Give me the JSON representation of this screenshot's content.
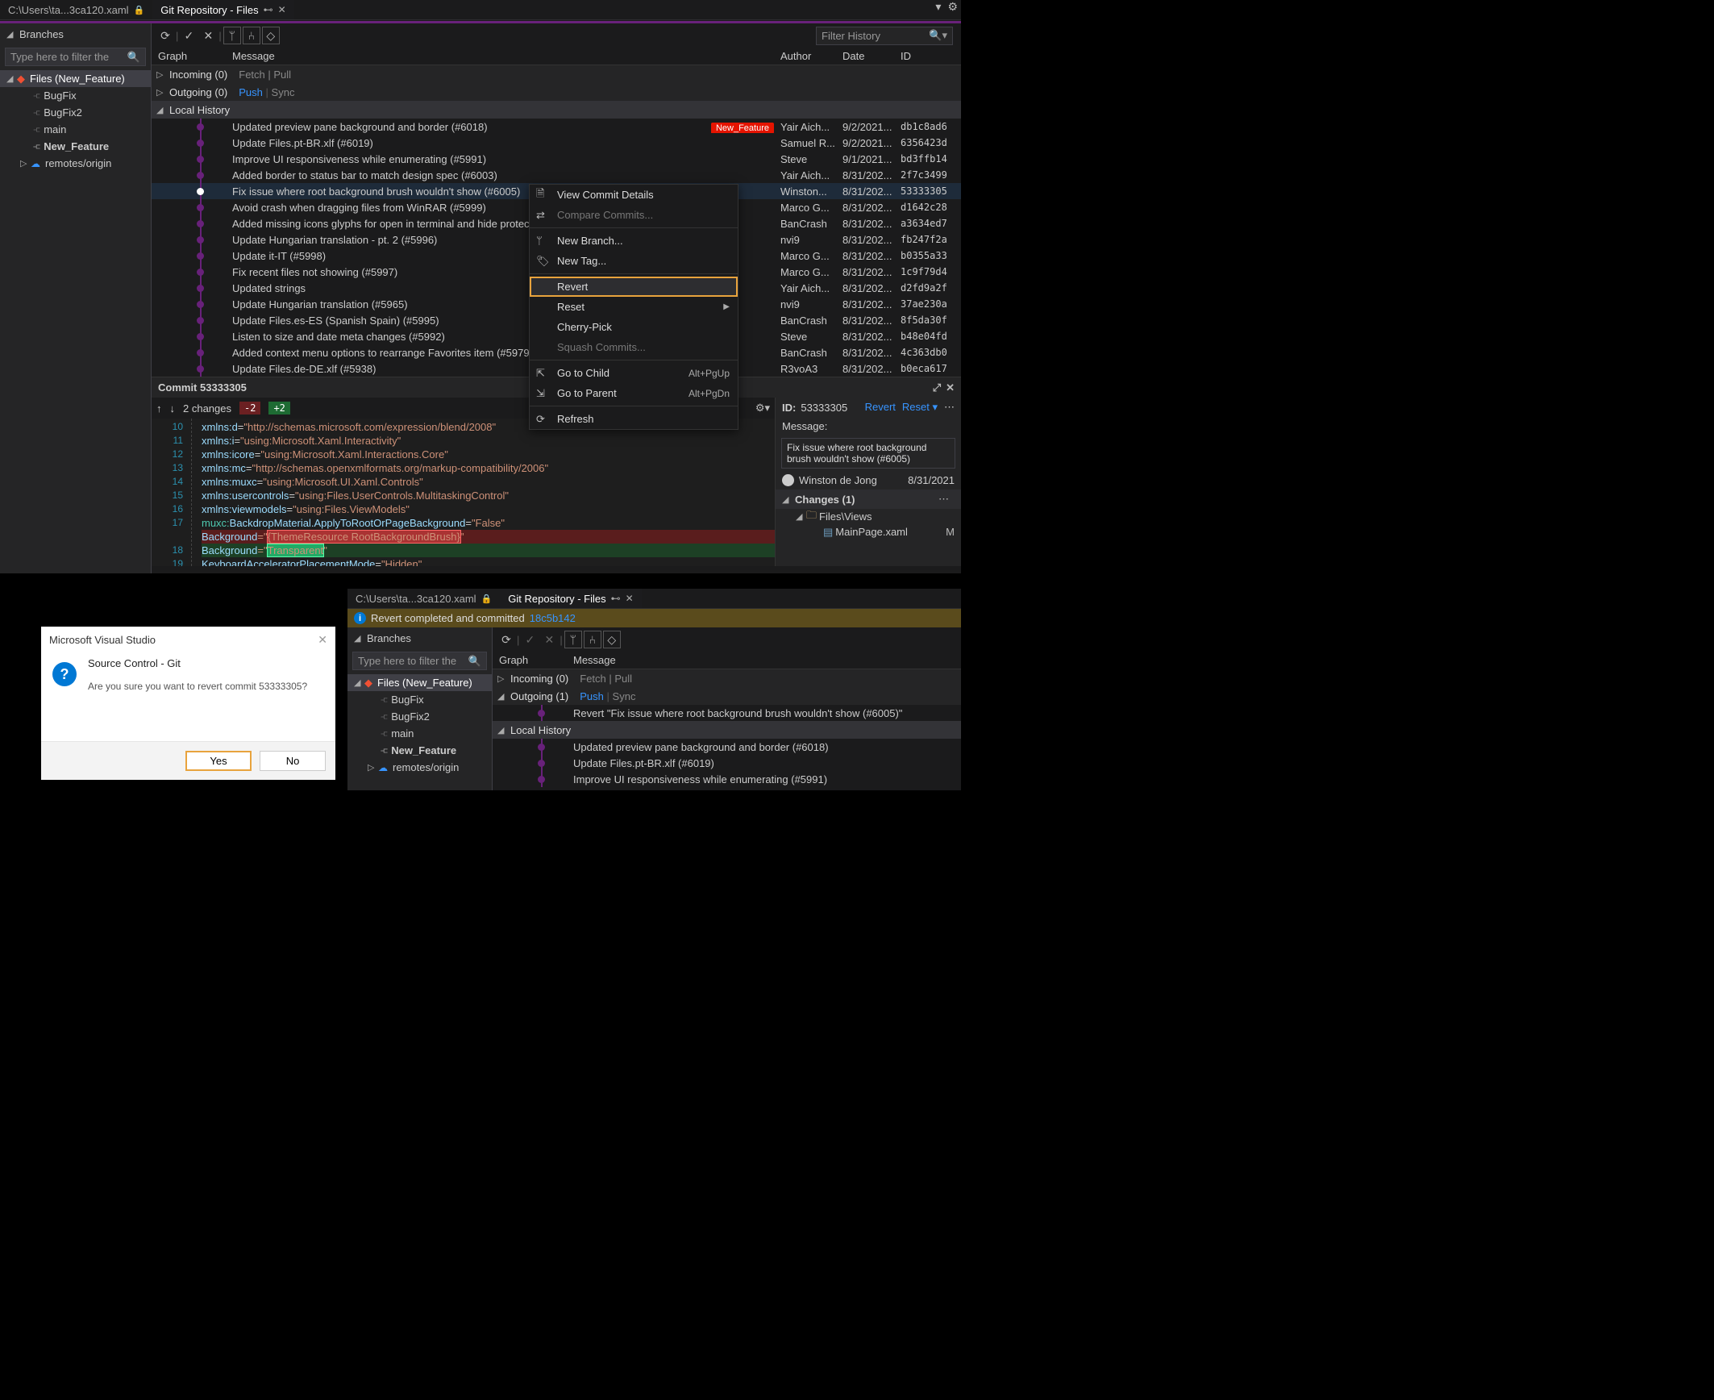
{
  "tabs": {
    "file_tab": "C:\\Users\\ta...3ca120.xaml",
    "repo_tab": "Git Repository - Files"
  },
  "branches": {
    "title": "Branches",
    "search_placeholder": "Type here to filter the",
    "current": "Files (New_Feature)",
    "local": [
      "BugFix",
      "BugFix2",
      "main",
      "New_Feature"
    ],
    "remotes_label": "remotes/origin"
  },
  "toolbar": {
    "filter_placeholder": "Filter History"
  },
  "columns": {
    "graph": "Graph",
    "message": "Message",
    "author": "Author",
    "date": "Date",
    "id": "ID"
  },
  "sections": {
    "incoming": "Incoming (0)",
    "incoming_fetch": "Fetch",
    "incoming_pull": "Pull",
    "outgoing": "Outgoing (0)",
    "outgoing_push": "Push",
    "outgoing_sync": "Sync",
    "outgoing1": "Outgoing (1)",
    "local_history": "Local History"
  },
  "tag": "New_Feature",
  "commits": [
    {
      "msg": "Updated preview pane background and border (#6018)",
      "author": "Yair Aich...",
      "date": "9/2/2021...",
      "id": "db1c8ad6",
      "tag": true
    },
    {
      "msg": "Update Files.pt-BR.xlf (#6019)",
      "author": "Samuel R...",
      "date": "9/2/2021...",
      "id": "6356423d"
    },
    {
      "msg": "Improve UI responsiveness while enumerating (#5991)",
      "author": "Steve",
      "date": "9/1/2021...",
      "id": "bd3ffb14"
    },
    {
      "msg": "Added border to status bar to match design spec (#6003)",
      "author": "Yair Aich...",
      "date": "8/31/202...",
      "id": "2f7c3499"
    },
    {
      "msg": "Fix issue where root background brush wouldn't show (#6005)",
      "author": "Winston...",
      "date": "8/31/202...",
      "id": "53333305",
      "sel": true
    },
    {
      "msg": " Avoid crash when dragging files from WinRAR (#5999)",
      "author": "Marco G...",
      "date": "8/31/202...",
      "id": "d1642c28"
    },
    {
      "msg": "Added missing icons glyphs for open in terminal and hide protect",
      "author": "BanCrash",
      "date": "8/31/202...",
      "id": "a3634ed7"
    },
    {
      "msg": "Update Hungarian translation - pt. 2 (#5996)",
      "author": "nvi9",
      "date": "8/31/202...",
      "id": "fb247f2a"
    },
    {
      "msg": "Update it-IT (#5998)",
      "author": "Marco G...",
      "date": "8/31/202...",
      "id": "b0355a33"
    },
    {
      "msg": "Fix recent files not showing (#5997)",
      "author": "Marco G...",
      "date": "8/31/202...",
      "id": "1c9f79d4"
    },
    {
      "msg": "Updated strings",
      "author": "Yair Aich...",
      "date": "8/31/202...",
      "id": "d2fd9a2f"
    },
    {
      "msg": "Update Hungarian translation (#5965)",
      "author": "nvi9",
      "date": "8/31/202...",
      "id": "37ae230a"
    },
    {
      "msg": "Update Files.es-ES (Spanish Spain) (#5995)",
      "author": "BanCrash",
      "date": "8/31/202...",
      "id": "8f5da30f"
    },
    {
      "msg": "Listen to size and date meta changes (#5992)",
      "author": "Steve",
      "date": "8/31/202...",
      "id": "b48e04fd"
    },
    {
      "msg": "Added context menu options to rearrange Favorites item (#5979)",
      "author": "BanCrash",
      "date": "8/31/202...",
      "id": "4c363db0"
    },
    {
      "msg": "Update Files.de-DE.xlf (#5938)",
      "author": "R3voA3",
      "date": "8/31/202...",
      "id": "b0eca617"
    }
  ],
  "context_menu": {
    "view_details": "View Commit Details",
    "compare": "Compare Commits...",
    "new_branch": "New Branch...",
    "new_tag": "New Tag...",
    "revert": "Revert",
    "reset": "Reset",
    "cherry_pick": "Cherry-Pick",
    "squash": "Squash Commits...",
    "go_child": "Go to Child",
    "go_child_key": "Alt+PgUp",
    "go_parent": "Go to Parent",
    "go_parent_key": "Alt+PgDn",
    "refresh": "Refresh"
  },
  "commit_detail": {
    "title": "Commit 53333305",
    "changes_count": "2 changes",
    "minus": "-2",
    "plus": "+2",
    "gutter": [
      "10",
      "11",
      "12",
      "13",
      "14",
      "15",
      "16",
      "17",
      "",
      "18",
      "19"
    ],
    "id_label": "ID:",
    "id": "53333305",
    "revert": "Revert",
    "reset": "Reset ▾",
    "msg_label": "Message:",
    "msg": "Fix issue where root background brush wouldn't show (#6005)",
    "author": "Winston de Jong",
    "date": "8/31/2021",
    "changes_label": "Changes (1)",
    "folder": "Files\\Views",
    "file": "MainPage.xaml",
    "file_badge": "M"
  },
  "code": {
    "l10a": "xmlns:",
    "l10b": "d",
    "l10c": "=",
    "l10d": "\"http://schemas.microsoft.com/expression/blend/2008\"",
    "l11a": "xmlns:",
    "l11b": "i",
    "l11c": "=",
    "l11d": "\"using:Microsoft.Xaml.Interactivity\"",
    "l12a": "xmlns:",
    "l12b": "icore",
    "l12c": "=",
    "l12d": "\"using:Microsoft.Xaml.Interactions.Core\"",
    "l13a": "xmlns:",
    "l13b": "mc",
    "l13c": "=",
    "l13d": "\"http://schemas.openxmlformats.org/markup-compatibility/2006\"",
    "l14a": "xmlns:",
    "l14b": "muxc",
    "l14c": "=",
    "l14d": "\"using:Microsoft.UI.Xaml.Controls\"",
    "l15a": "xmlns:",
    "l15b": "usercontrols",
    "l15c": "=",
    "l15d": "\"using:Files.UserControls.MultitaskingControl\"",
    "l16a": "xmlns:",
    "l16b": "viewmodels",
    "l16c": "=",
    "l16d": "\"using:Files.ViewModels\"",
    "l17a": "muxc:",
    "l17b": "BackdropMaterial.ApplyToRootOrPageBackground",
    "l17c": "=",
    "l17d": "\"False\"",
    "lrem_a": "Background",
    "lrem_b": "=\"",
    "lrem_c": "{ThemeResource RootBackgroundBrush}",
    "lrem_d": "\"",
    "ladd_a": "Background",
    "ladd_b": "=\"",
    "ladd_c": "Transparent",
    "ladd_d": "\"",
    "l19a": "KeyboardAcceleratorPlacementMode",
    "l19b": "=",
    "l19c": "\"Hidden\""
  },
  "dialog": {
    "window_title": "Microsoft Visual Studio",
    "heading": "Source Control - Git",
    "body": "Are you sure you want to revert commit 53333305?",
    "yes": "Yes",
    "no": "No"
  },
  "ide2": {
    "info": "Revert completed and committed ",
    "info_hash": "18c5b142",
    "revert_msg": "Revert \"Fix issue where root background brush wouldn't show (#6005)\"",
    "commits": [
      "Updated preview pane background and border (#6018)",
      "Update Files.pt-BR.xlf (#6019)",
      "Improve UI responsiveness while enumerating (#5991)"
    ]
  }
}
